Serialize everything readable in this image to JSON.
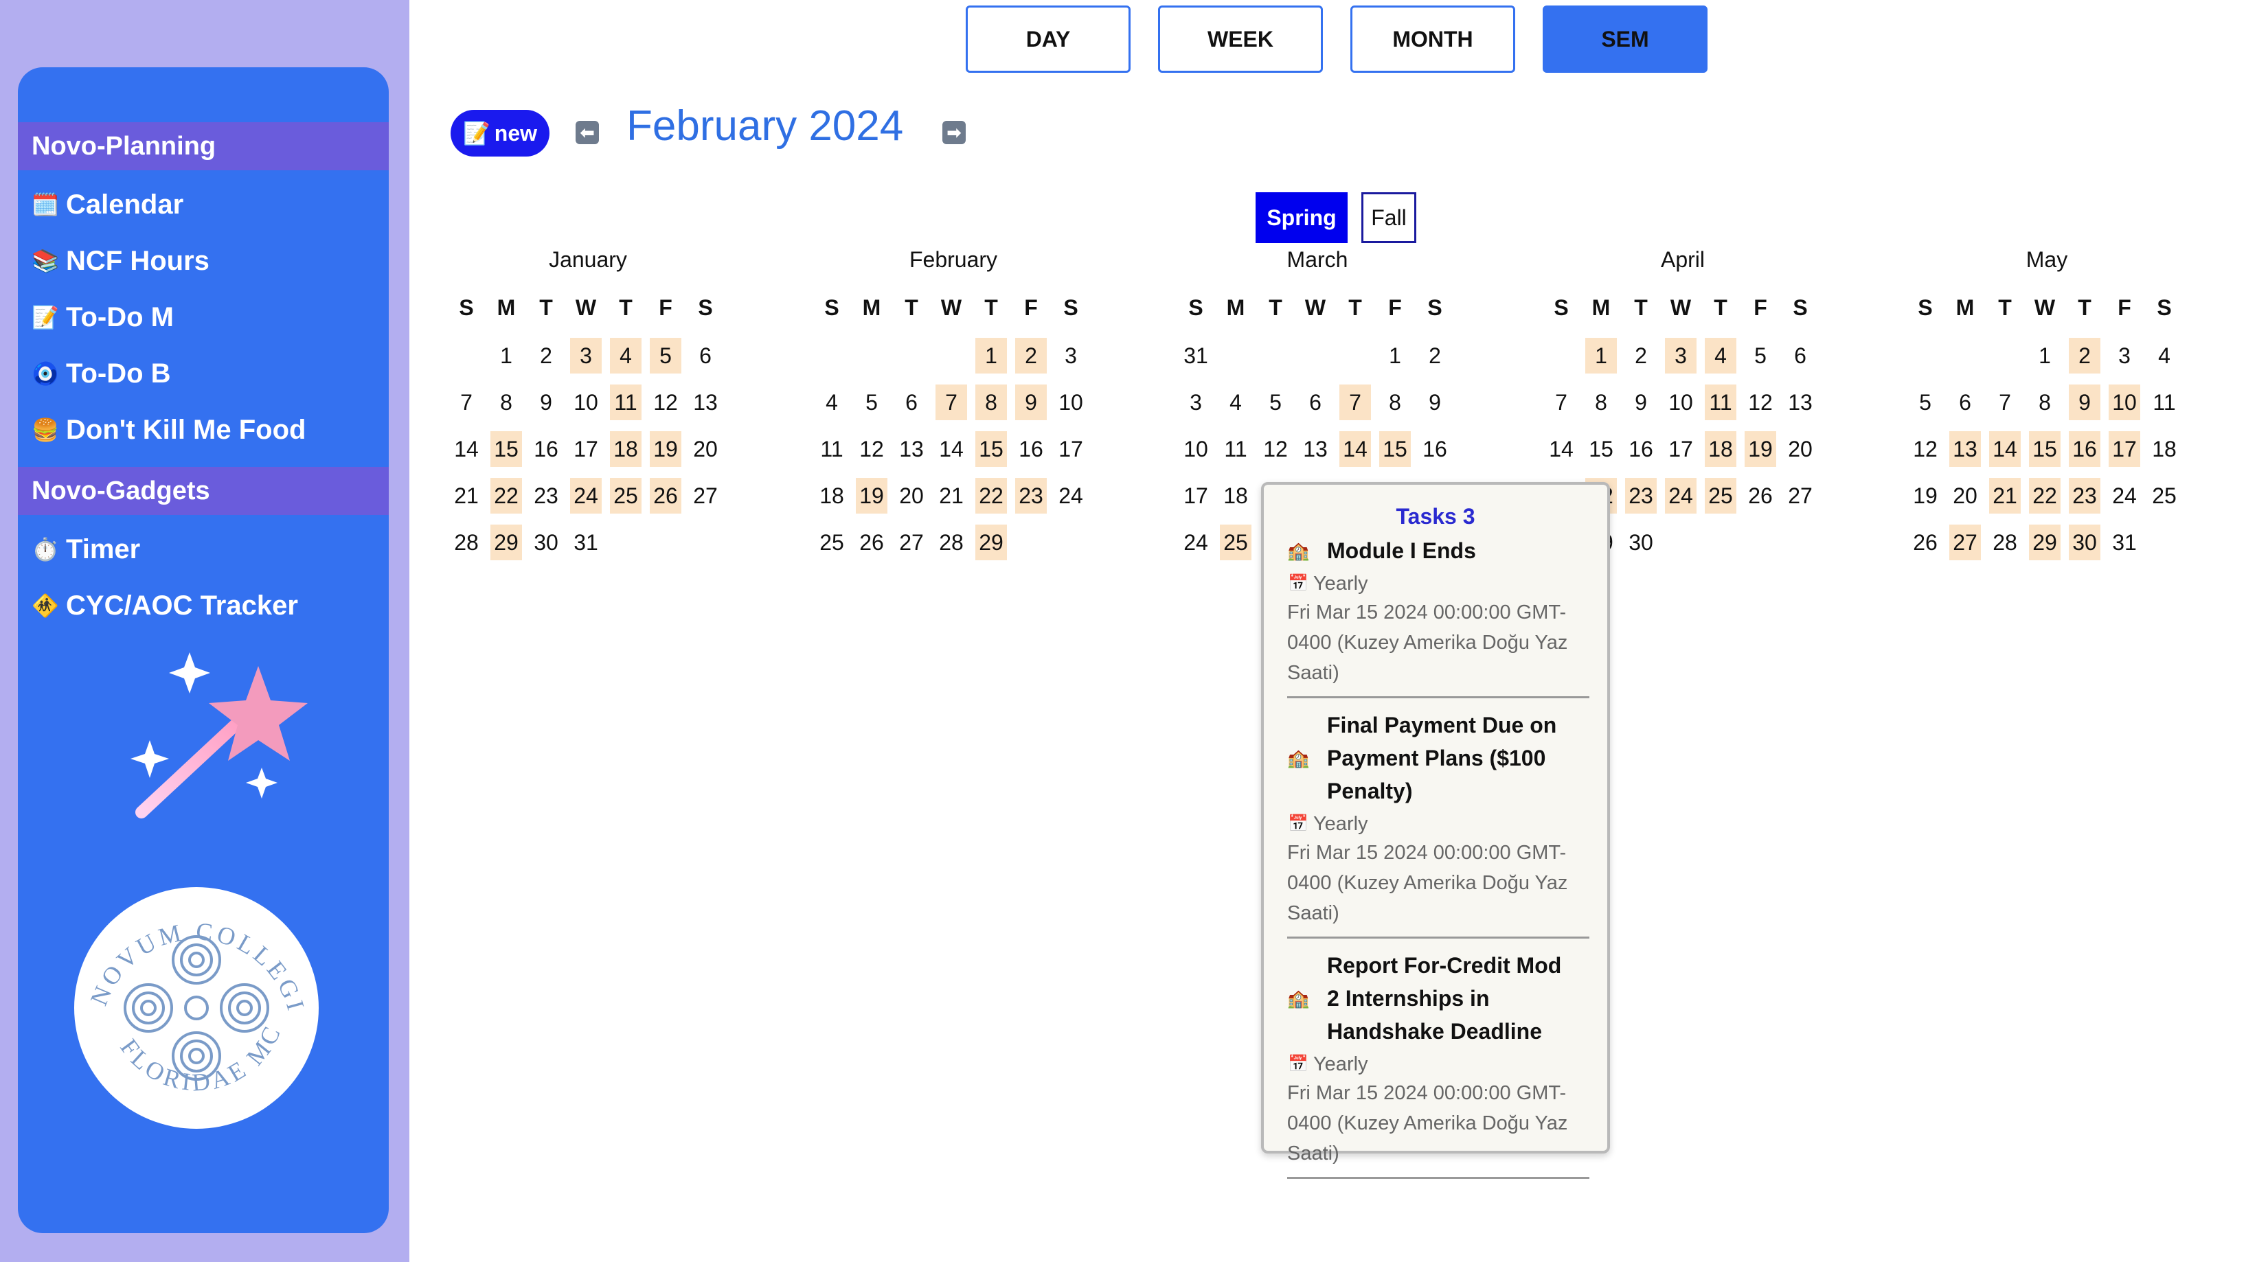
{
  "sidebar": {
    "sections": [
      {
        "label": "Novo-Planning"
      },
      {
        "label": "Novo-Gadgets"
      }
    ],
    "items": [
      {
        "label": "Calendar",
        "icon": "calendar-icon",
        "glyph": "🗓️"
      },
      {
        "label": "NCF Hours",
        "icon": "books-icon",
        "glyph": "📚"
      },
      {
        "label": "To-Do M",
        "icon": "memo-icon",
        "glyph": "📝"
      },
      {
        "label": "To-Do B",
        "icon": "nazar-eye-icon",
        "glyph": "🧿"
      },
      {
        "label": "Don't Kill Me Food",
        "icon": "burger-icon",
        "glyph": "🍔"
      },
      {
        "label": "Timer",
        "icon": "stopwatch-icon",
        "glyph": "⏱️"
      },
      {
        "label": "CYC/AOC Tracker",
        "icon": "construction-sign-icon",
        "glyph": "🚸"
      }
    ],
    "seal_text": "NOVUM COLLEGIUM FLORIDAE MCMLX"
  },
  "views": {
    "day": "DAY",
    "week": "WEEK",
    "month": "MONTH",
    "sem": "SEM",
    "active": "SEM"
  },
  "header": {
    "new_label": "new",
    "new_glyph": "📝",
    "prev_glyph": "⬅",
    "next_glyph": "➡",
    "title": "February 2024"
  },
  "semester": {
    "spring": "Spring",
    "fall": "Fall",
    "active": "Spring"
  },
  "weekdays": [
    "S",
    "M",
    "T",
    "W",
    "T",
    "F",
    "S"
  ],
  "months": [
    {
      "name": "January",
      "weeks": [
        [
          "",
          "1",
          "2",
          "3",
          "4",
          "5",
          "6"
        ],
        [
          "7",
          "8",
          "9",
          "10",
          "11",
          "12",
          "13"
        ],
        [
          "14",
          "15",
          "16",
          "17",
          "18",
          "19",
          "20"
        ],
        [
          "21",
          "22",
          "23",
          "24",
          "25",
          "26",
          "27"
        ],
        [
          "28",
          "29",
          "30",
          "31",
          "",
          "",
          ""
        ]
      ],
      "highlighted": [
        "3",
        "4",
        "5",
        "11",
        "15",
        "18",
        "19",
        "22",
        "24",
        "25",
        "26",
        "29"
      ]
    },
    {
      "name": "February",
      "weeks": [
        [
          "",
          "",
          "",
          "",
          "1",
          "2",
          "3"
        ],
        [
          "4",
          "5",
          "6",
          "7",
          "8",
          "9",
          "10"
        ],
        [
          "11",
          "12",
          "13",
          "14",
          "15",
          "16",
          "17"
        ],
        [
          "18",
          "19",
          "20",
          "21",
          "22",
          "23",
          "24"
        ],
        [
          "25",
          "26",
          "27",
          "28",
          "29",
          "",
          ""
        ]
      ],
      "highlighted": [
        "1",
        "2",
        "7",
        "8",
        "9",
        "15",
        "19",
        "22",
        "23",
        "29"
      ]
    },
    {
      "name": "March",
      "weeks": [
        [
          "31",
          "",
          "",
          "",
          "",
          "1",
          "2"
        ],
        [
          "3",
          "4",
          "5",
          "6",
          "7",
          "8",
          "9"
        ],
        [
          "10",
          "11",
          "12",
          "13",
          "14",
          "15",
          "16"
        ],
        [
          "17",
          "18",
          "",
          "",
          "",
          "",
          ""
        ],
        [
          "24",
          "25",
          "",
          "",
          "",
          "",
          ""
        ]
      ],
      "highlighted": [
        "7",
        "14",
        "15",
        "25"
      ]
    },
    {
      "name": "April",
      "weeks": [
        [
          "",
          "1",
          "2",
          "3",
          "4",
          "5",
          "6"
        ],
        [
          "7",
          "8",
          "9",
          "10",
          "11",
          "12",
          "13"
        ],
        [
          "14",
          "15",
          "16",
          "17",
          "18",
          "19",
          "20"
        ],
        [
          "",
          "22",
          "23",
          "24",
          "25",
          "26",
          "27"
        ],
        [
          "",
          "29",
          "30",
          "",
          "",
          "",
          ""
        ]
      ],
      "highlighted": [
        "1",
        "3",
        "4",
        "11",
        "18",
        "19",
        "22",
        "23",
        "24",
        "25"
      ]
    },
    {
      "name": "May",
      "weeks": [
        [
          "",
          "",
          "",
          "1",
          "2",
          "3",
          "4"
        ],
        [
          "5",
          "6",
          "7",
          "8",
          "9",
          "10",
          "11"
        ],
        [
          "12",
          "13",
          "14",
          "15",
          "16",
          "17",
          "18"
        ],
        [
          "19",
          "20",
          "21",
          "22",
          "23",
          "24",
          "25"
        ],
        [
          "26",
          "27",
          "28",
          "29",
          "30",
          "31",
          ""
        ]
      ],
      "highlighted": [
        "2",
        "9",
        "10",
        "13",
        "14",
        "15",
        "16",
        "17",
        "21",
        "22",
        "23",
        "27",
        "29",
        "30"
      ]
    }
  ],
  "popover": {
    "title": "Tasks 3",
    "tasks": [
      {
        "name_lines": [
          "Module I Ends"
        ],
        "icon": "school-icon",
        "glyph": "🏫",
        "repeat_glyph": "📅",
        "repeat": "Yearly",
        "date_lines": [
          "Fri Mar 15 2024 00:00:00 GMT-",
          "0400 (Kuzey Amerika Doğu Yaz",
          "Saati)"
        ]
      },
      {
        "name_lines": [
          "Final Payment Due on",
          "Payment Plans ($100",
          "Penalty)"
        ],
        "icon": "school-icon",
        "glyph": "🏫",
        "repeat_glyph": "📅",
        "repeat": "Yearly",
        "date_lines": [
          "Fri Mar 15 2024 00:00:00 GMT-",
          "0400 (Kuzey Amerika Doğu Yaz",
          "Saati)"
        ]
      },
      {
        "name_lines": [
          "Report For-Credit Mod",
          "2 Internships in",
          "Handshake Deadline"
        ],
        "icon": "school-icon",
        "glyph": "🏫",
        "repeat_glyph": "📅",
        "repeat": "Yearly",
        "date_lines": [
          "Fri Mar 15 2024 00:00:00 GMT-",
          "0400 (Kuzey Amerika Doğu Yaz",
          "Saati)"
        ]
      }
    ]
  },
  "colors": {
    "sidebar_bg": "#b3aef0",
    "sidebar_panel": "#3471f0",
    "section_bg": "#6a5cdc",
    "accent": "#3471f0",
    "highlight": "#fbe3c6",
    "title": "#2f6fe3"
  }
}
